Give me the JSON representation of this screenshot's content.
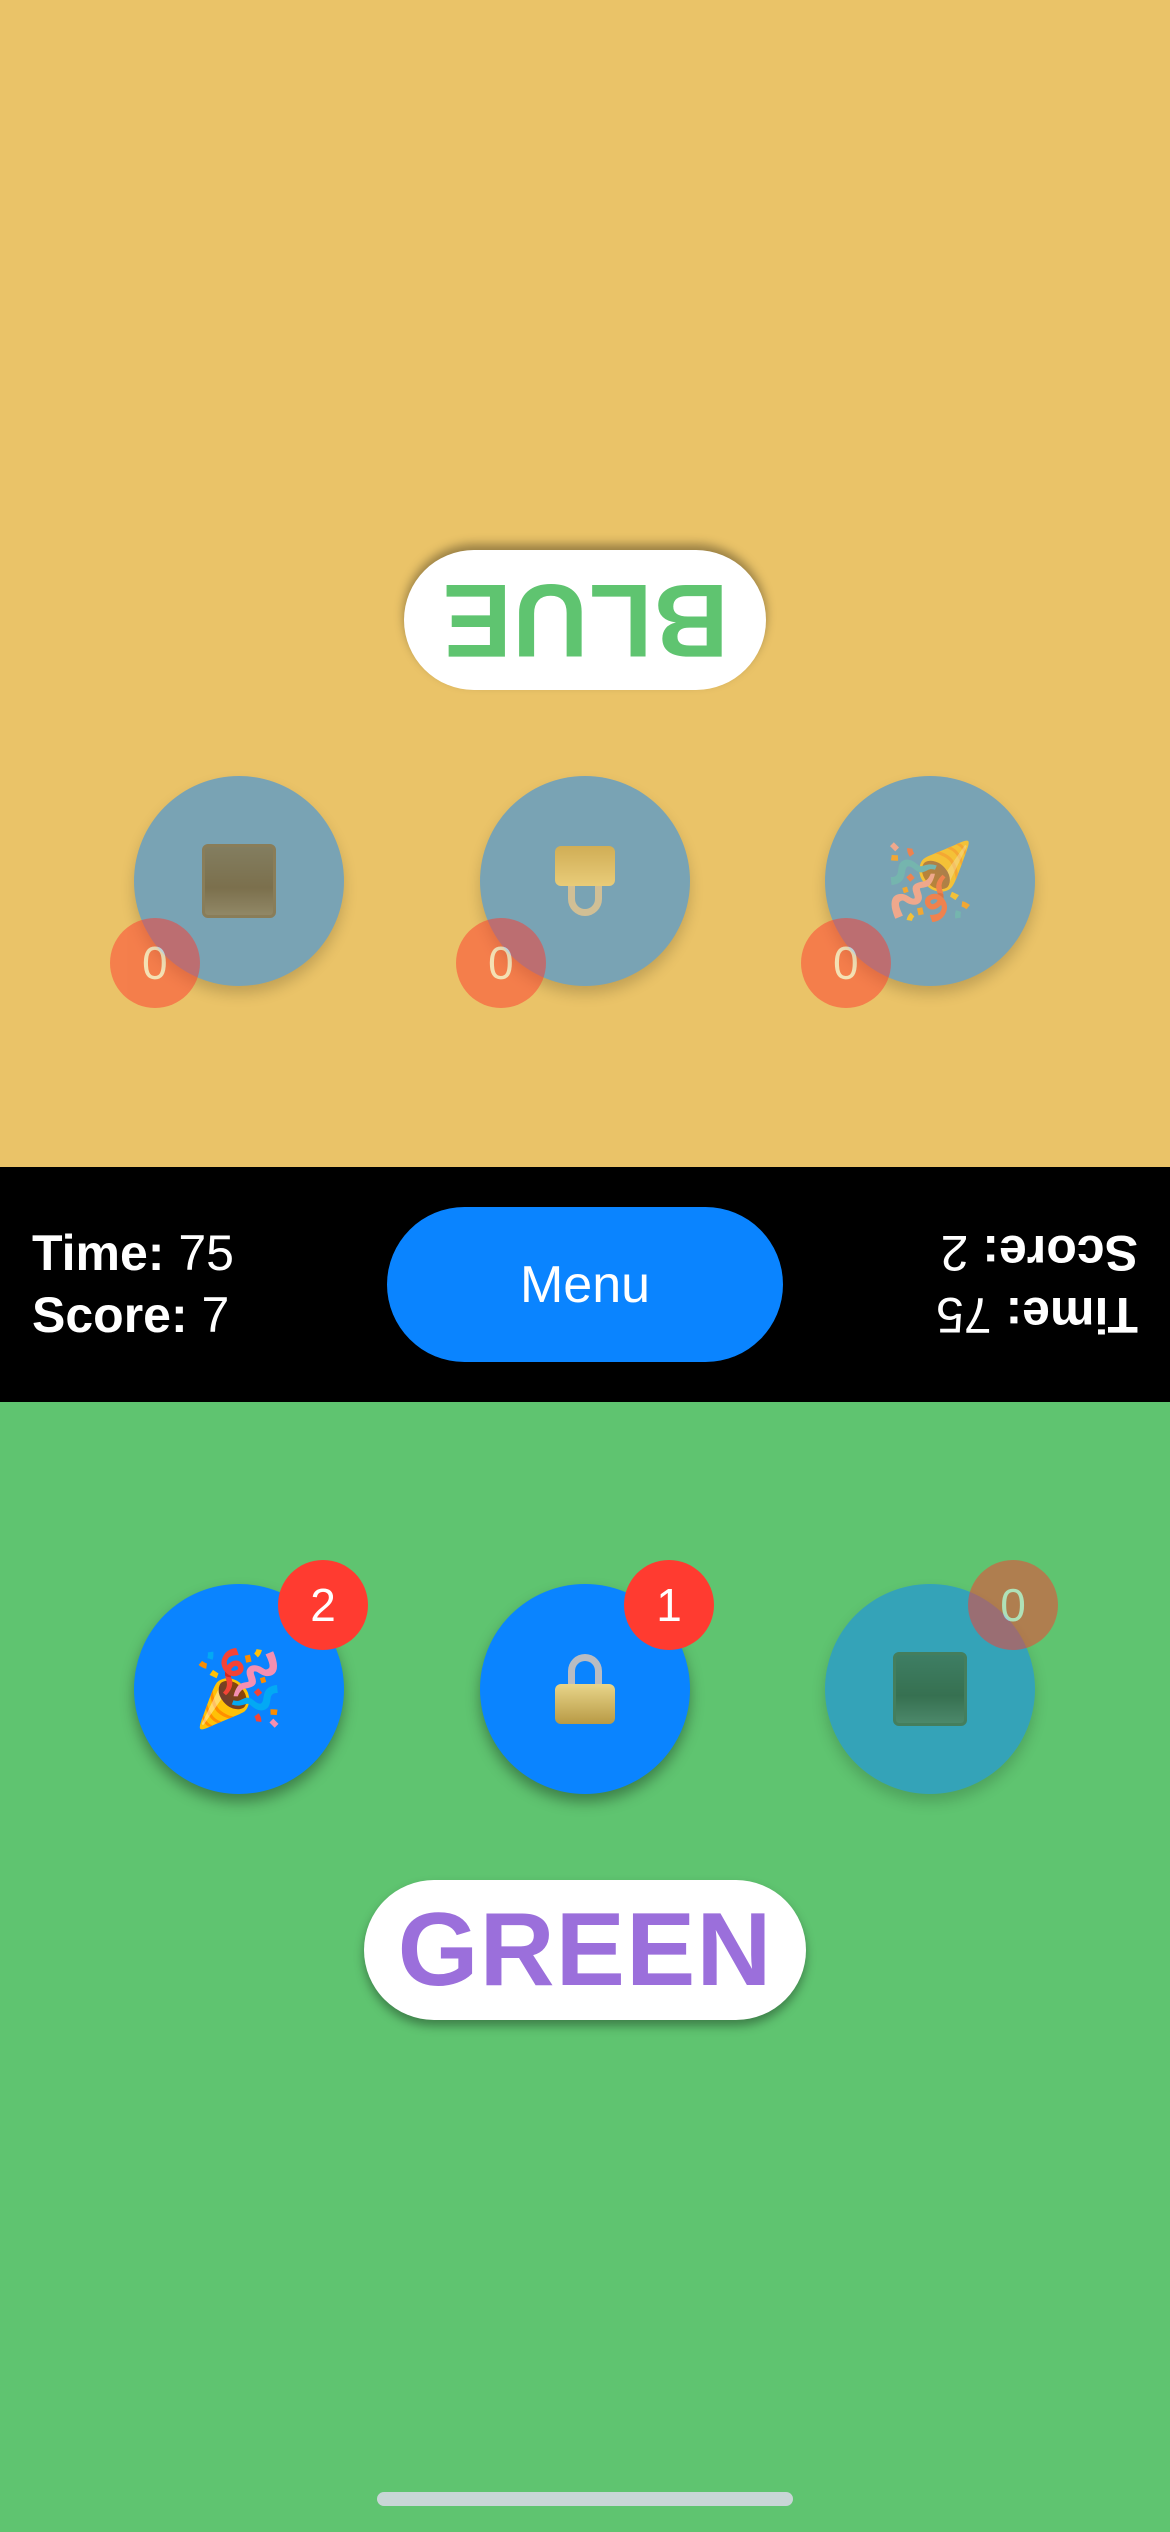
{
  "top_player": {
    "word": "BLUE",
    "word_color": "#5FC470",
    "buttons": [
      {
        "icon": "square-icon",
        "count": "0",
        "active": false
      },
      {
        "icon": "lock-icon",
        "count": "0",
        "active": false
      },
      {
        "icon": "party-popper-icon",
        "glyph": "🎉",
        "count": "0",
        "active": false
      }
    ],
    "hud": {
      "time_label": "Time:",
      "time": "75",
      "score_label": "Score:",
      "score": "2"
    }
  },
  "bottom_player": {
    "word": "GREEN",
    "word_color": "#9B6FDB",
    "buttons": [
      {
        "icon": "party-popper-icon",
        "glyph": "🎉",
        "count": "2",
        "active": true
      },
      {
        "icon": "lock-icon",
        "count": "1",
        "active": true
      },
      {
        "icon": "square-icon",
        "count": "0",
        "active": false
      }
    ],
    "hud": {
      "time_label": "Time:",
      "time": "75",
      "score_label": "Score:",
      "score": "7"
    }
  },
  "menu": {
    "label": "Menu"
  },
  "colors": {
    "top_background": "#EAC368",
    "bottom_background": "#5FC470",
    "accent": "#0A84FF",
    "badge": "#FF3B30"
  }
}
